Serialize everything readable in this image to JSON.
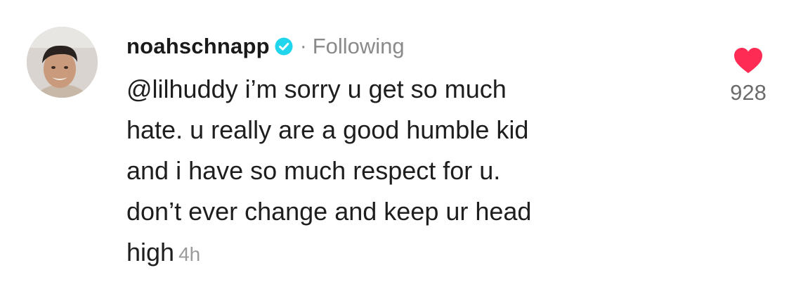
{
  "comment": {
    "username": "noahschnapp",
    "separator": "·",
    "follow_status": "Following",
    "lines": [
      "@lilhuddy i’m sorry u get so much",
      "hate. u really are a good humble kid",
      "and i have so much respect for u.",
      "don’t ever change and keep ur head",
      "high"
    ],
    "timestamp": "4h",
    "like_count": "928"
  },
  "icons": {
    "verified": "verified-badge-icon",
    "like": "heart-icon"
  },
  "colors": {
    "verified_badge": "#20d5ec",
    "heart": "#fe2c55",
    "secondary_text": "#8a8a8a"
  }
}
